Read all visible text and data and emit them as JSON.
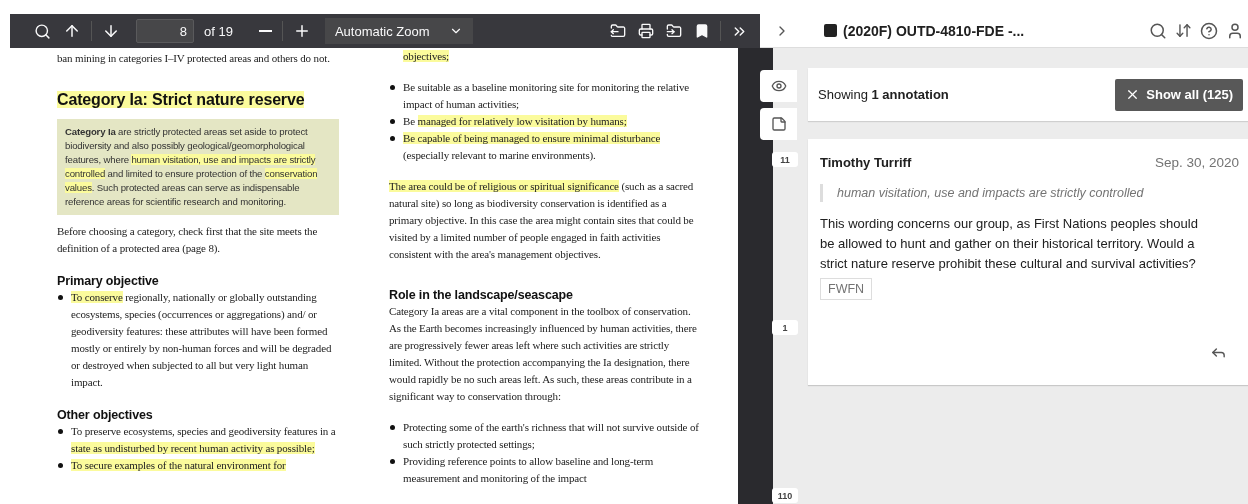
{
  "toolbar": {
    "page_number": "8",
    "page_count": "of 19",
    "zoom": "Automatic Zoom"
  },
  "page": {
    "columns": [
      [
        {
          "kind": "paragraph",
          "segments": [
            {
              "text": "ban mining in categories I–IV protected areas and others do not.",
              "highlighted": false
            }
          ]
        },
        {
          "kind": "title",
          "segments": [
            {
              "text": "Category Ia: Strict nature reserve",
              "highlighted": true
            }
          ]
        },
        {
          "kind": "callout",
          "segments": [
            {
              "text": "**Category Ia** are strictly protected areas set aside to protect biodiversity and also possibly geological/geomorphological features, where ",
              "highlighted": false
            },
            {
              "text": "human visitation, use and impacts are strictly controlled",
              "highlighted": true
            },
            {
              "text": " and limited to ensure protection of the ",
              "highlighted": false
            },
            {
              "text": "conservation values",
              "highlighted": true
            },
            {
              "text": ". Such protected areas can serve as indispensable reference areas for scientific research and monitoring.",
              "highlighted": false
            }
          ]
        },
        {
          "kind": "paragraph",
          "segments": [
            {
              "text": "Before choosing a category, check first that the site meets the definition of a protected area (page 8).",
              "highlighted": false
            }
          ]
        },
        {
          "kind": "heading",
          "segments": [
            {
              "text": "Primary objective",
              "highlighted": false
            }
          ]
        },
        {
          "kind": "bullets",
          "items": [
            {
              "segments": [
                {
                  "text": "To conserve",
                  "highlighted": true
                },
                {
                  "text": " regionally, nationally or globally outstanding ecosystems, species (occurrences or aggregations) and/ or geodiversity features: these attributes will have been formed mostly or entirely by non-human forces and will be degraded or destroyed when subjected to all but very light human impact.",
                  "highlighted": false
                }
              ]
            }
          ]
        },
        {
          "kind": "heading",
          "segments": [
            {
              "text": "Other objectives",
              "highlighted": false
            }
          ]
        },
        {
          "kind": "bullets",
          "items": [
            {
              "segments": [
                {
                  "text": "To preserve ecosystems, species and geodiversity features in a ",
                  "highlighted": false
                },
                {
                  "text": "state as undisturbed by recent human activity as possible;",
                  "highlighted": true
                }
              ]
            },
            {
              "segments": [
                {
                  "text": "To secure examples of the natural environment for",
                  "highlighted": true
                }
              ]
            }
          ]
        }
      ],
      [
        {
          "kind": "continuation",
          "segments": [
            {
              "text": "objectives;",
              "highlighted": true
            }
          ]
        },
        {
          "kind": "bullets",
          "items": [
            {
              "segments": [
                {
                  "text": "Be suitable as a baseline monitoring site for monitoring the relative impact of human activities;",
                  "highlighted": false
                }
              ]
            },
            {
              "segments": [
                {
                  "text": "Be ",
                  "highlighted": false
                },
                {
                  "text": "managed for relatively low visitation by humans;",
                  "highlighted": true
                }
              ]
            },
            {
              "segments": [
                {
                  "text": "Be capable of being managed to ensure minimal disturbance",
                  "highlighted": true
                },
                {
                  "text": " (especially relevant to marine environments).",
                  "highlighted": false
                }
              ]
            }
          ]
        },
        {
          "kind": "paragraph",
          "segments": [
            {
              "text": "The area could be of religious or spiritual significance",
              "highlighted": true
            },
            {
              "text": " (such as a sacred natural site) so long as biodiversity conservation is identified as a primary objective. In this case the area might contain sites that could be visited by a limited number of people engaged in faith activities consistent with the area's management objectives.",
              "highlighted": false
            }
          ]
        },
        {
          "kind": "heading",
          "segments": [
            {
              "text": "Role in the landscape/seascape",
              "highlighted": false
            }
          ]
        },
        {
          "kind": "tight",
          "segments": [
            {
              "text": "Category Ia areas are a vital component in the toolbox of conservation. As the Earth becomes increasingly influenced by human activities, there are progressively fewer areas left where such activities are strictly limited. Without the protection accompanying the Ia designation, there would rapidly be no such areas left. As such, these areas contribute in a significant way to conservation through:",
              "highlighted": false
            }
          ]
        },
        {
          "kind": "bullets",
          "items": [
            {
              "segments": [
                {
                  "text": "Protecting some of the earth's richness that will not survive outside of such strictly protected settings;",
                  "highlighted": false
                }
              ]
            },
            {
              "segments": [
                {
                  "text": "Providing reference points to allow baseline and long-term measurement and monitoring of the impact",
                  "highlighted": false
                }
              ]
            }
          ]
        }
      ]
    ]
  },
  "sidebar": {
    "title": "(2020F) OUTD-4810-FDE -...",
    "buckets": [
      {
        "label": "11",
        "kind": "up"
      },
      {
        "label": "1",
        "kind": "left"
      },
      {
        "label": "110",
        "kind": "down"
      }
    ],
    "filter": {
      "text": "Showing **1 annotation**",
      "button": "Show all (125)"
    },
    "annotation": {
      "author": "Timothy Turriff",
      "date": "Sep. 30, 2020",
      "quote": "human visitation, use and impacts are strictly controlled",
      "body": "This wording concerns our group, as First Nations peoples should be allowed to hunt and gather on their historical territory. Would a strict nature reserve prohibit these cultural and survival activities?",
      "tags": [
        "FWFN"
      ]
    }
  }
}
